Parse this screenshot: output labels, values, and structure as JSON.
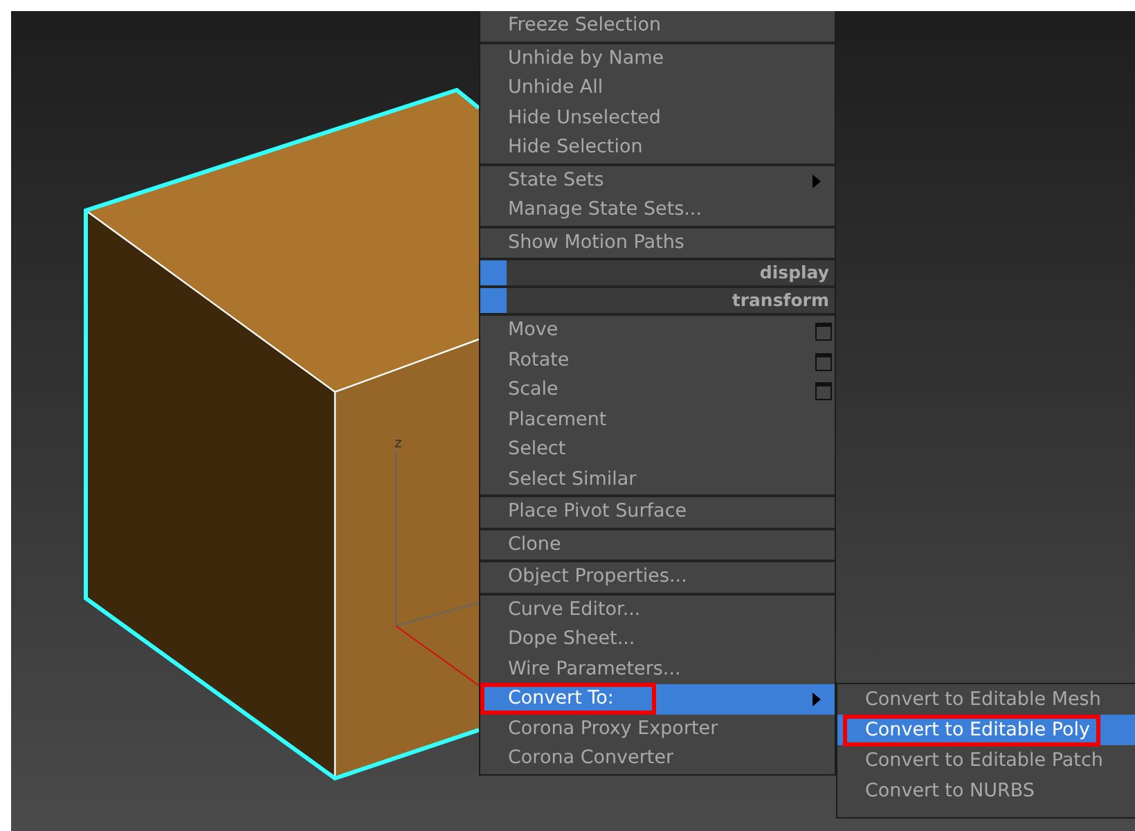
{
  "viewport": {
    "axis_label": "z"
  },
  "context_menu": {
    "groups": [
      {
        "items": [
          {
            "kind": "item",
            "label": "Freeze Selection",
            "selected": false,
            "highlighted": false,
            "has_submenu": false,
            "option_box": false
          }
        ]
      },
      {
        "items": [
          {
            "kind": "item",
            "label": "Unhide by Name",
            "selected": false,
            "highlighted": false,
            "has_submenu": false,
            "option_box": false
          },
          {
            "kind": "item",
            "label": "Unhide All",
            "selected": false,
            "highlighted": false,
            "has_submenu": false,
            "option_box": false
          },
          {
            "kind": "item",
            "label": "Hide Unselected",
            "selected": false,
            "highlighted": false,
            "has_submenu": false,
            "option_box": false
          },
          {
            "kind": "item",
            "label": "Hide Selection",
            "selected": false,
            "highlighted": false,
            "has_submenu": false,
            "option_box": false
          }
        ]
      },
      {
        "items": [
          {
            "kind": "item",
            "label": "State Sets",
            "selected": false,
            "highlighted": false,
            "has_submenu": true,
            "option_box": false
          },
          {
            "kind": "item",
            "label": "Manage State Sets...",
            "selected": false,
            "highlighted": false,
            "has_submenu": false,
            "option_box": false
          }
        ]
      },
      {
        "items": [
          {
            "kind": "item",
            "label": "Show Motion Paths",
            "selected": false,
            "highlighted": false,
            "has_submenu": false,
            "option_box": false
          }
        ]
      },
      {
        "items": [
          {
            "kind": "header",
            "label": "display"
          }
        ]
      },
      {
        "items": [
          {
            "kind": "header",
            "label": "transform"
          }
        ]
      },
      {
        "items": [
          {
            "kind": "item",
            "label": "Move",
            "selected": false,
            "highlighted": false,
            "has_submenu": false,
            "option_box": true
          },
          {
            "kind": "item",
            "label": "Rotate",
            "selected": false,
            "highlighted": false,
            "has_submenu": false,
            "option_box": true
          },
          {
            "kind": "item",
            "label": "Scale",
            "selected": false,
            "highlighted": false,
            "has_submenu": false,
            "option_box": true
          },
          {
            "kind": "item",
            "label": "Placement",
            "selected": false,
            "highlighted": false,
            "has_submenu": false,
            "option_box": false
          },
          {
            "kind": "item",
            "label": "Select",
            "selected": false,
            "highlighted": false,
            "has_submenu": false,
            "option_box": false
          },
          {
            "kind": "item",
            "label": "Select Similar",
            "selected": false,
            "highlighted": false,
            "has_submenu": false,
            "option_box": false
          }
        ]
      },
      {
        "items": [
          {
            "kind": "item",
            "label": "Place Pivot Surface",
            "selected": false,
            "highlighted": false,
            "has_submenu": false,
            "option_box": false
          }
        ]
      },
      {
        "items": [
          {
            "kind": "item",
            "label": "Clone",
            "selected": false,
            "highlighted": false,
            "has_submenu": false,
            "option_box": false
          }
        ]
      },
      {
        "items": [
          {
            "kind": "item",
            "label": "Object Properties...",
            "selected": false,
            "highlighted": false,
            "has_submenu": false,
            "option_box": false
          }
        ]
      },
      {
        "items": [
          {
            "kind": "item",
            "label": "Curve Editor...",
            "selected": false,
            "highlighted": false,
            "has_submenu": false,
            "option_box": false
          },
          {
            "kind": "item",
            "label": "Dope Sheet...",
            "selected": false,
            "highlighted": false,
            "has_submenu": false,
            "option_box": false
          },
          {
            "kind": "item",
            "label": "Wire Parameters...",
            "selected": false,
            "highlighted": false,
            "has_submenu": false,
            "option_box": false
          },
          {
            "kind": "item",
            "label": "Convert To:",
            "selected": true,
            "highlighted": true,
            "has_submenu": true,
            "option_box": false
          },
          {
            "kind": "item",
            "label": "Corona Proxy Exporter",
            "selected": false,
            "highlighted": false,
            "has_submenu": false,
            "option_box": false
          },
          {
            "kind": "item",
            "label": "Corona Converter",
            "selected": false,
            "highlighted": false,
            "has_submenu": false,
            "option_box": false
          }
        ]
      }
    ]
  },
  "submenu": {
    "items": [
      {
        "label": "Convert to Editable Mesh",
        "selected": false,
        "highlighted": false
      },
      {
        "label": "Convert to Editable Poly",
        "selected": true,
        "highlighted": true
      },
      {
        "label": "Convert to Editable Patch",
        "selected": false,
        "highlighted": false
      },
      {
        "label": "Convert to NURBS",
        "selected": false,
        "highlighted": false
      }
    ]
  }
}
